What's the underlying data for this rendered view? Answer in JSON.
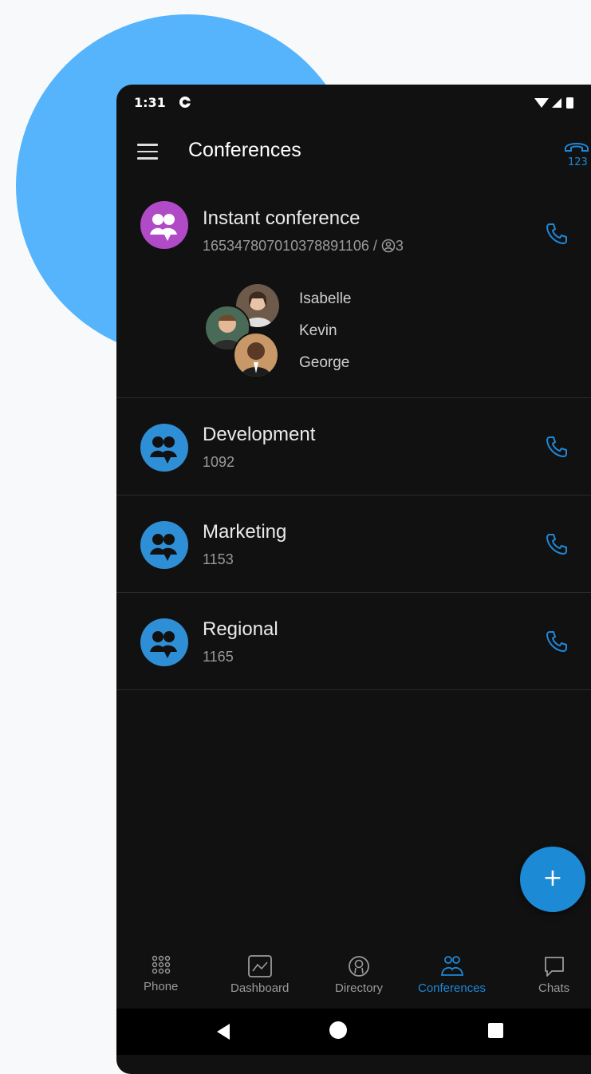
{
  "status_bar": {
    "time": "1:31"
  },
  "app_bar": {
    "title": "Conferences"
  },
  "conferences": [
    {
      "name": "Instant conference",
      "number": "16534780701037889​1106 / ",
      "participant_count": "3",
      "participants": [
        "Isabelle",
        "Kevin",
        "George"
      ],
      "avatar_color": "#b04ac6"
    },
    {
      "name": "Development",
      "number": "1092",
      "avatar_color": "#2f8fd6"
    },
    {
      "name": "Marketing",
      "number": "1153",
      "avatar_color": "#2f8fd6"
    },
    {
      "name": "Regional",
      "number": "1165",
      "avatar_color": "#2f8fd6"
    }
  ],
  "fab": {
    "label": "+"
  },
  "bottom_nav": [
    {
      "label": "Phone",
      "icon": "dialpad-icon",
      "active": false
    },
    {
      "label": "Dashboard",
      "icon": "chart-icon",
      "active": false
    },
    {
      "label": "Directory",
      "icon": "directory-icon",
      "active": false
    },
    {
      "label": "Conferences",
      "icon": "conference-icon",
      "active": true
    },
    {
      "label": "Chats",
      "icon": "chat-icon",
      "active": false
    }
  ],
  "colors": {
    "accent": "#1e88d8",
    "background": "#111111",
    "blob": "#55b4fb"
  }
}
